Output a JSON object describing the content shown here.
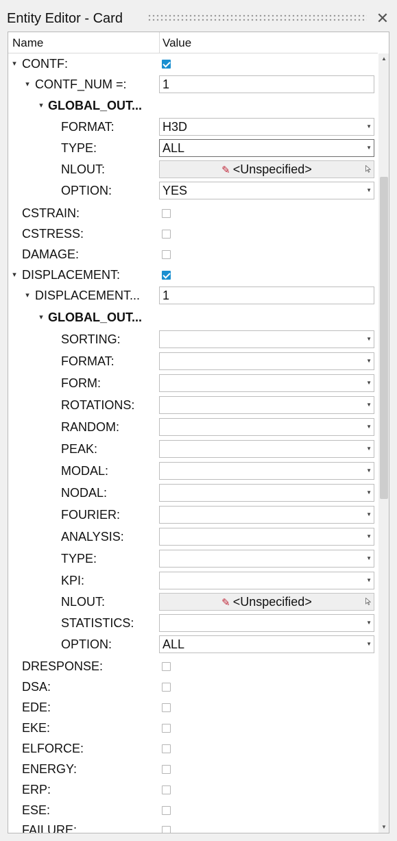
{
  "window": {
    "title": "Entity Editor - Card"
  },
  "columns": {
    "name": "Name",
    "value": "Value"
  },
  "rows": [
    {
      "label": "CONTF:",
      "checked": true
    },
    {
      "label": "CONTF_NUM =:",
      "value": "1"
    },
    {
      "label": "GLOBAL_OUT..."
    },
    {
      "label": "FORMAT:",
      "value": "H3D"
    },
    {
      "label": "TYPE:",
      "value": "ALL"
    },
    {
      "label": "NLOUT:",
      "value": "<Unspecified>"
    },
    {
      "label": "OPTION:",
      "value": "YES"
    },
    {
      "label": "CSTRAIN:",
      "checked": false
    },
    {
      "label": "CSTRESS:",
      "checked": false
    },
    {
      "label": "DAMAGE:",
      "checked": false
    },
    {
      "label": "DISPLACEMENT:",
      "checked": true
    },
    {
      "label": "DISPLACEMENT...",
      "value": "1"
    },
    {
      "label": "GLOBAL_OUT..."
    },
    {
      "label": "SORTING:",
      "value": ""
    },
    {
      "label": "FORMAT:",
      "value": ""
    },
    {
      "label": "FORM:",
      "value": ""
    },
    {
      "label": "ROTATIONS:",
      "value": ""
    },
    {
      "label": "RANDOM:",
      "value": ""
    },
    {
      "label": "PEAK:",
      "value": ""
    },
    {
      "label": "MODAL:",
      "value": ""
    },
    {
      "label": "NODAL:",
      "value": ""
    },
    {
      "label": "FOURIER:",
      "value": ""
    },
    {
      "label": "ANALYSIS:",
      "value": ""
    },
    {
      "label": "TYPE:",
      "value": ""
    },
    {
      "label": "KPI:",
      "value": ""
    },
    {
      "label": "NLOUT:",
      "value": "<Unspecified>"
    },
    {
      "label": "STATISTICS:",
      "value": ""
    },
    {
      "label": "OPTION:",
      "value": "ALL"
    },
    {
      "label": "DRESPONSE:",
      "checked": false
    },
    {
      "label": "DSA:",
      "checked": false
    },
    {
      "label": "EDE:",
      "checked": false
    },
    {
      "label": "EKE:",
      "checked": false
    },
    {
      "label": "ELFORCE:",
      "checked": false
    },
    {
      "label": "ENERGY:",
      "checked": false
    },
    {
      "label": "ERP:",
      "checked": false
    },
    {
      "label": "ESE:",
      "checked": false
    },
    {
      "label": "FAILURE:",
      "checked": false
    }
  ],
  "icons": {
    "close": "close-icon",
    "expand": "expand-arrow-icon",
    "nlout": "pen-icon",
    "pointer": "cursor-pointer-icon",
    "dropdown": "dropdown-arrow-icon"
  },
  "colors": {
    "checkbox_on": "#1a8fd0",
    "pen_icon": "#c0283a"
  }
}
